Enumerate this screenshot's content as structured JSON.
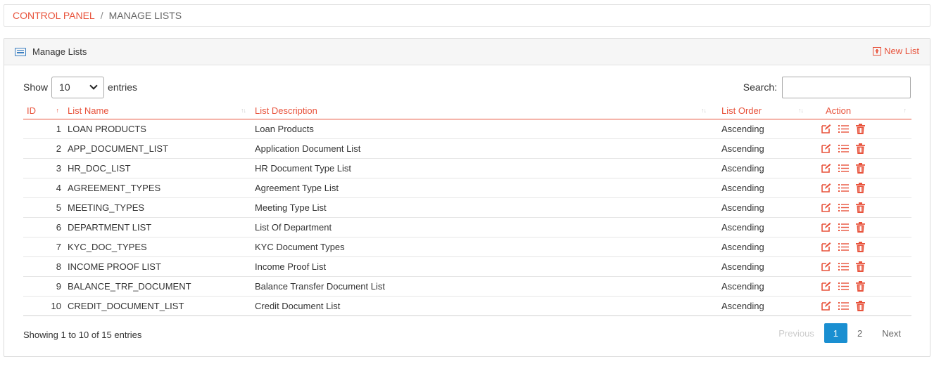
{
  "breadcrumb": {
    "root": "CONTROL PANEL",
    "separator": "/",
    "current": "MANAGE LISTS"
  },
  "panel": {
    "title": "Manage Lists",
    "new_label": "New List"
  },
  "length": {
    "prefix": "Show",
    "value": "10",
    "suffix": "entries"
  },
  "search": {
    "label": "Search:",
    "value": ""
  },
  "columns": [
    "ID",
    "List Name",
    "List Description",
    "List Order",
    "Action"
  ],
  "rows": [
    {
      "id": "1",
      "name": "LOAN PRODUCTS",
      "description": "Loan Products",
      "order": "Ascending"
    },
    {
      "id": "2",
      "name": "APP_DOCUMENT_LIST",
      "description": "Application Document List",
      "order": "Ascending"
    },
    {
      "id": "3",
      "name": "HR_DOC_LIST",
      "description": "HR Document Type List",
      "order": "Ascending"
    },
    {
      "id": "4",
      "name": "AGREEMENT_TYPES",
      "description": "Agreement Type List",
      "order": "Ascending"
    },
    {
      "id": "5",
      "name": "MEETING_TYPES",
      "description": "Meeting Type List",
      "order": "Ascending"
    },
    {
      "id": "6",
      "name": "DEPARTMENT LIST",
      "description": "List Of Department",
      "order": "Ascending"
    },
    {
      "id": "7",
      "name": "KYC_DOC_TYPES",
      "description": "KYC Document Types",
      "order": "Ascending"
    },
    {
      "id": "8",
      "name": "INCOME PROOF LIST",
      "description": "Income Proof List",
      "order": "Ascending"
    },
    {
      "id": "9",
      "name": "BALANCE_TRF_DOCUMENT",
      "description": "Balance Transfer Document List",
      "order": "Ascending"
    },
    {
      "id": "10",
      "name": "CREDIT_DOCUMENT_LIST",
      "description": "Credit Document List",
      "order": "Ascending"
    }
  ],
  "row_action_icons": [
    "edit-icon",
    "list-icon",
    "trash-icon"
  ],
  "info": "Showing 1 to 10 of 15 entries",
  "pagination": {
    "previous": "Previous",
    "pages": [
      "1",
      "2"
    ],
    "active_page": "1",
    "next": "Next"
  },
  "colors": {
    "accent": "#e8533c",
    "active_page": "#1a8fd1",
    "panel_icon": "#3a7fc1"
  }
}
